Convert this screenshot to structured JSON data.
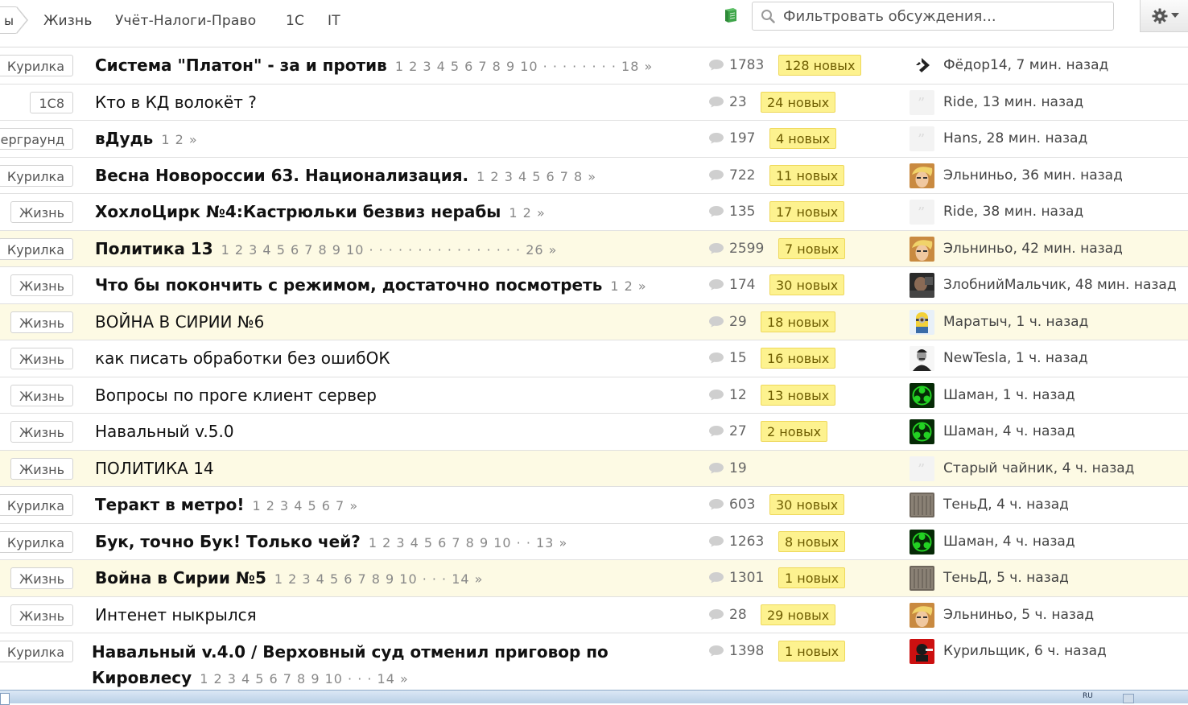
{
  "nav": {
    "crumb_cut": "ы",
    "items": [
      "Жизнь",
      "Учёт-Налоги-Право",
      "1С",
      "IT"
    ]
  },
  "search": {
    "placeholder": "Фильтровать обсуждения..."
  },
  "badge_suffix": "новых",
  "time_suffix": "назад",
  "colors": {
    "badge_bg": "#fdf28f",
    "highlight_row": "#fdfae4",
    "book_icon": "#3fa54a"
  },
  "threads": [
    {
      "category": "Курилка",
      "title": "Система \"Платон\" - за и против",
      "bold": true,
      "pages": "1 2 3 4 5 6 7 8 9 10 · · · · · · · · 18 »",
      "count": "1783",
      "new": "128 новых",
      "avatar": "diamond-avatar",
      "author": "Фёдор14",
      "time": "7 мин. назад",
      "highlight": false
    },
    {
      "category": "1С8",
      "title": "Кто в КД волокёт ?",
      "bold": false,
      "pages": "",
      "count": "23",
      "new": "24 новых",
      "avatar": "quote-avatar",
      "author": "Ride",
      "time": "13 мин. назад",
      "highlight": false
    },
    {
      "category": "ерграунд",
      "title": "вДудь",
      "bold": true,
      "pages": "1 2 »",
      "count": "197",
      "new": "4 новых",
      "avatar": "quote-avatar",
      "author": "Hans",
      "time": "28 мин. назад",
      "highlight": false
    },
    {
      "category": "Курилка",
      "title": "Весна Новороссии 63. Национализация.",
      "bold": true,
      "pages": "1 2 3 4 5 6 7 8 »",
      "count": "722",
      "new": "11 новых",
      "avatar": "blonde-avatar",
      "author": "Эльниньо",
      "time": "36 мин. назад",
      "highlight": false
    },
    {
      "category": "Жизнь",
      "title": "ХохлоЦирк №4:Кастрюльки безвиз нерабы",
      "bold": true,
      "pages": "1 2 »",
      "count": "135",
      "new": "17 новых",
      "avatar": "quote-avatar",
      "author": "Ride",
      "time": "38 мин. назад",
      "highlight": false
    },
    {
      "category": "Курилка",
      "title": "Политика 13",
      "bold": true,
      "pages": "1 2 3 4 5 6 7 8 9 10 · · · · · · · · · · · · · · · · 26 »",
      "count": "2599",
      "new": "7 новых",
      "avatar": "blonde-avatar",
      "author": "Эльниньо",
      "time": "42 мин. назад",
      "highlight": true
    },
    {
      "category": "Жизнь",
      "title": "Что бы покончить с режимом, достаточно посмотреть",
      "bold": true,
      "pages": "1 2 »",
      "count": "174",
      "new": "30 новых",
      "avatar": "dark-avatar",
      "author": "ЗлобнийМальчик",
      "time": "48 мин. назад",
      "highlight": false
    },
    {
      "category": "Жизнь",
      "title": "ВОЙНА В СИРИИ №6",
      "bold": false,
      "pages": "",
      "count": "29",
      "new": "18 новых",
      "avatar": "minion-avatar",
      "author": "Маратыч",
      "time": "1 ч. назад",
      "highlight": true
    },
    {
      "category": "Жизнь",
      "title": "как писать обработки без ошибОК",
      "bold": false,
      "pages": "",
      "count": "15",
      "new": "16 новых",
      "avatar": "portrait-avatar",
      "author": "NewTesla",
      "time": "1 ч. назад",
      "highlight": false
    },
    {
      "category": "Жизнь",
      "title": "Вопросы по проге клиент сервер",
      "bold": false,
      "pages": "",
      "count": "12",
      "new": "13 новых",
      "avatar": "biohazard-avatar",
      "author": "Шаман",
      "time": "1 ч. назад",
      "highlight": false
    },
    {
      "category": "Жизнь",
      "title": "Навальный v.5.0",
      "bold": false,
      "pages": "",
      "count": "27",
      "new": "2 новых",
      "avatar": "biohazard-avatar",
      "author": "Шаман",
      "time": "4 ч. назад",
      "highlight": false
    },
    {
      "category": "Жизнь",
      "title": "ПОЛИТИКА 14",
      "bold": false,
      "pages": "",
      "count": "19",
      "new": "",
      "avatar": "quote-avatar",
      "author": "Старый чайник",
      "time": "4 ч. назад",
      "highlight": true
    },
    {
      "category": "Курилка",
      "title": "Теракт в метро!",
      "bold": true,
      "pages": "1 2 3 4 5 6 7 »",
      "count": "603",
      "new": "30 новых",
      "avatar": "metal-avatar",
      "author": "ТеньД",
      "time": "4 ч. назад",
      "highlight": false
    },
    {
      "category": "Курилка",
      "title": "Бук, точно Бук! Только чей?",
      "bold": true,
      "pages": "1 2 3 4 5 6 7 8 9 10 · · 13 »",
      "count": "1263",
      "new": "8 новых",
      "avatar": "biohazard-avatar",
      "author": "Шаман",
      "time": "4 ч. назад",
      "highlight": false
    },
    {
      "category": "Жизнь",
      "title": "Война в Сирии №5",
      "bold": true,
      "pages": "1 2 3 4 5 6 7 8 9 10 · · · 14 »",
      "count": "1301",
      "new": "1 новых",
      "avatar": "metal-avatar",
      "author": "ТеньД",
      "time": "5 ч. назад",
      "highlight": true
    },
    {
      "category": "Жизнь",
      "title": "Интенет ныкрылся",
      "bold": false,
      "pages": "",
      "count": "28",
      "new": "29 новых",
      "avatar": "blonde-avatar",
      "author": "Эльниньо",
      "time": "5 ч. назад",
      "highlight": false
    },
    {
      "category": "Курилка",
      "title": "Навальный v.4.0 / Верховный суд отменил приговор по Кировлесу",
      "bold": true,
      "pages": "1 2 3 4 5 6 7 8 9 10 · · · 14 »",
      "count": "1398",
      "new": "1 новых",
      "avatar": "red-avatar",
      "author": "Курильщик",
      "time": "6 ч. назад",
      "highlight": false
    }
  ],
  "taskbar": {
    "lang": "RU"
  }
}
